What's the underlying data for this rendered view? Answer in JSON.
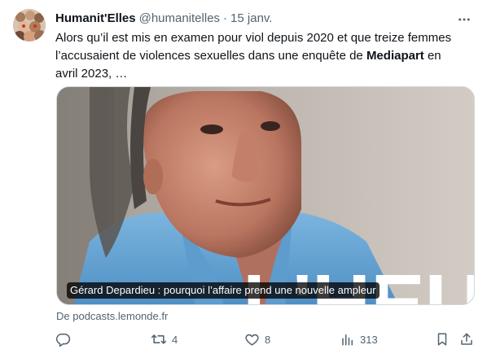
{
  "tweet": {
    "display_name": "Humanit'Elles",
    "handle": "@humanitelles",
    "separator": "·",
    "date": "15 janv.",
    "text_part1": "Alors qu’il est mis en examen pour viol depuis 2020 et que treize femmes l’accusaient de violences sexuelles dans une enquête de ",
    "text_bold": "Mediapart",
    "text_part2": " en avril 2023, …"
  },
  "card": {
    "caption": "Gérard Depardieu : pourquoi l’affaire prend une nouvelle ampleur",
    "overlay_text": "L'HEURE",
    "source": "De podcasts.lemonde.fr"
  },
  "actions": {
    "replies": "",
    "retweets": "4",
    "likes": "8",
    "views": "313"
  },
  "icons": {
    "more": "more-horizontal-icon",
    "reply": "reply-icon",
    "retweet": "retweet-icon",
    "like": "heart-icon",
    "views": "analytics-icon",
    "bookmark": "bookmark-icon",
    "share": "share-icon"
  },
  "colors": {
    "text": "#0f1419",
    "secondary": "#536471",
    "border": "#cfd9de",
    "shirt": "#6fa9d6"
  }
}
